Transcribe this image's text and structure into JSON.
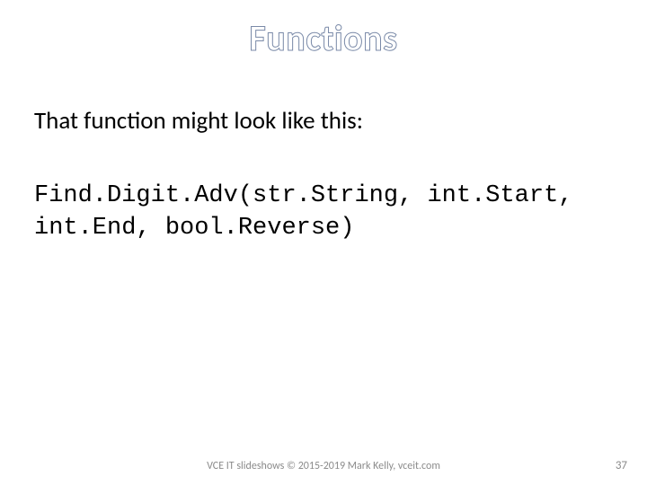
{
  "title": "Functions",
  "lead": "That function might look like this:",
  "code_line1": "Find.Digit.Adv(str.String, int.Start,",
  "code_line2": "int.End, bool.Reverse)",
  "footer": "VCE IT slideshows © 2015-2019 Mark Kelly, vceit.com",
  "page_number": "37"
}
